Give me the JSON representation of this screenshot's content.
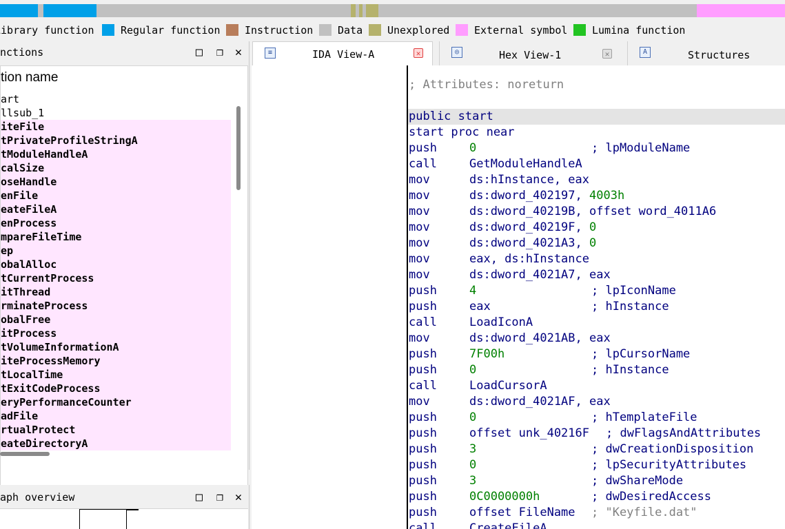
{
  "colors": {
    "library_function": "#00a0e8",
    "regular_function": "#00a0e8",
    "instruction": "#b87d5b",
    "data": "#c0c0c0",
    "unexplored": "#b5b26c",
    "external_symbol": "#ff9dff",
    "lumina_function": "#22c422",
    "import_row_bg": "#ffe6ff",
    "code_text": "#00007f",
    "code_number": "#008000",
    "code_comment_gray": "#808080"
  },
  "legend": [
    {
      "label": "Library function",
      "color": "#00a0e8"
    },
    {
      "label": "Regular function",
      "color": "#00a0e8"
    },
    {
      "label": "Instruction",
      "color": "#b87d5b"
    },
    {
      "label": "Data",
      "color": "#c0c0c0"
    },
    {
      "label": "Unexplored",
      "color": "#b5b26c"
    },
    {
      "label": "External symbol",
      "color": "#ff9dff"
    },
    {
      "label": "Lumina function",
      "color": "#22c422"
    }
  ],
  "functions_panel": {
    "title": "nctions",
    "column_header": "tion name",
    "rows": [
      {
        "name": "art",
        "import": false
      },
      {
        "name": "llsub_1",
        "import": false
      },
      {
        "name": "iteFile",
        "import": true
      },
      {
        "name": "tPrivateProfileStringA",
        "import": true
      },
      {
        "name": "tModuleHandleA",
        "import": true
      },
      {
        "name": "calSize",
        "import": true
      },
      {
        "name": "oseHandle",
        "import": true
      },
      {
        "name": "enFile",
        "import": true
      },
      {
        "name": "eateFileA",
        "import": true
      },
      {
        "name": "enProcess",
        "import": true
      },
      {
        "name": "mpareFileTime",
        "import": true
      },
      {
        "name": "ep",
        "import": true
      },
      {
        "name": "obalAlloc",
        "import": true
      },
      {
        "name": "tCurrentProcess",
        "import": true
      },
      {
        "name": "itThread",
        "import": true
      },
      {
        "name": "rminateProcess",
        "import": true
      },
      {
        "name": "obalFree",
        "import": true
      },
      {
        "name": "itProcess",
        "import": true
      },
      {
        "name": "tVolumeInformationA",
        "import": true
      },
      {
        "name": "iteProcessMemory",
        "import": true
      },
      {
        "name": "tLocalTime",
        "import": true
      },
      {
        "name": "tExitCodeProcess",
        "import": true
      },
      {
        "name": "eryPerformanceCounter",
        "import": true
      },
      {
        "name": "adFile",
        "import": true
      },
      {
        "name": "rtualProtect",
        "import": true
      },
      {
        "name": "eateDirectoryA",
        "import": true
      }
    ]
  },
  "graph_panel": {
    "title": "aph overview"
  },
  "panel_buttons": {
    "maximize": "□",
    "restore": "❐",
    "close": "✕"
  },
  "tabs": [
    {
      "label": "IDA View-A",
      "icon": "ida-view-icon",
      "active": true
    },
    {
      "label": "Hex View-1",
      "icon": "hex-view-icon",
      "active": false
    },
    {
      "label": "Structures",
      "icon": "structures-icon",
      "active": false
    }
  ],
  "code": [
    {
      "text": "; Attributes: noreturn",
      "kind": "comment-gray"
    },
    {
      "text": "",
      "kind": "blank"
    },
    {
      "text": "public start",
      "kind": "label",
      "highlight": true
    },
    {
      "text": "start proc near",
      "kind": "label"
    },
    {
      "mn": "push",
      "op": "0",
      "op_number": true,
      "cm": "; lpModuleName"
    },
    {
      "mn": "call",
      "op": "GetModuleHandleA"
    },
    {
      "mn": "mov",
      "op": "ds:hInstance, eax"
    },
    {
      "mn": "mov",
      "op": "ds:dword_402197, ",
      "op_num_suffix": "4003h"
    },
    {
      "mn": "mov",
      "op": "ds:dword_40219B, offset word_4011A6"
    },
    {
      "mn": "mov",
      "op": "ds:dword_40219F, ",
      "op_num_suffix": "0"
    },
    {
      "mn": "mov",
      "op": "ds:dword_4021A3, ",
      "op_num_suffix": "0"
    },
    {
      "mn": "mov",
      "op": "eax, ds:hInstance"
    },
    {
      "mn": "mov",
      "op": "ds:dword_4021A7, eax"
    },
    {
      "mn": "push",
      "op": "4",
      "op_number": true,
      "cm": "; lpIconName"
    },
    {
      "mn": "push",
      "op": "eax",
      "cm": "; hInstance"
    },
    {
      "mn": "call",
      "op": "LoadIconA"
    },
    {
      "mn": "mov",
      "op": "ds:dword_4021AB, eax"
    },
    {
      "mn": "push",
      "op": "7F00h",
      "op_number": true,
      "cm": "; lpCursorName"
    },
    {
      "mn": "push",
      "op": "0",
      "op_number": true,
      "cm": "; hInstance"
    },
    {
      "mn": "call",
      "op": "LoadCursorA"
    },
    {
      "mn": "mov",
      "op": "ds:dword_4021AF, eax"
    },
    {
      "mn": "push",
      "op": "0",
      "op_number": true,
      "cm": "; hTemplateFile"
    },
    {
      "mn": "push",
      "op": "offset unk_40216F",
      "cm": "; dwFlagsAndAttributes"
    },
    {
      "mn": "push",
      "op": "3",
      "op_number": true,
      "cm": "; dwCreationDisposition"
    },
    {
      "mn": "push",
      "op": "0",
      "op_number": true,
      "cm": "; lpSecurityAttributes"
    },
    {
      "mn": "push",
      "op": "3",
      "op_number": true,
      "cm": "; dwShareMode"
    },
    {
      "mn": "push",
      "op": "0C0000000h",
      "op_number": true,
      "cm": "; dwDesiredAccess"
    },
    {
      "mn": "push",
      "op": "offset FileName",
      "cm": "; \"Keyfile.dat\"",
      "cm_gray": true
    },
    {
      "mn": "call",
      "op": "CreateFileA"
    }
  ]
}
